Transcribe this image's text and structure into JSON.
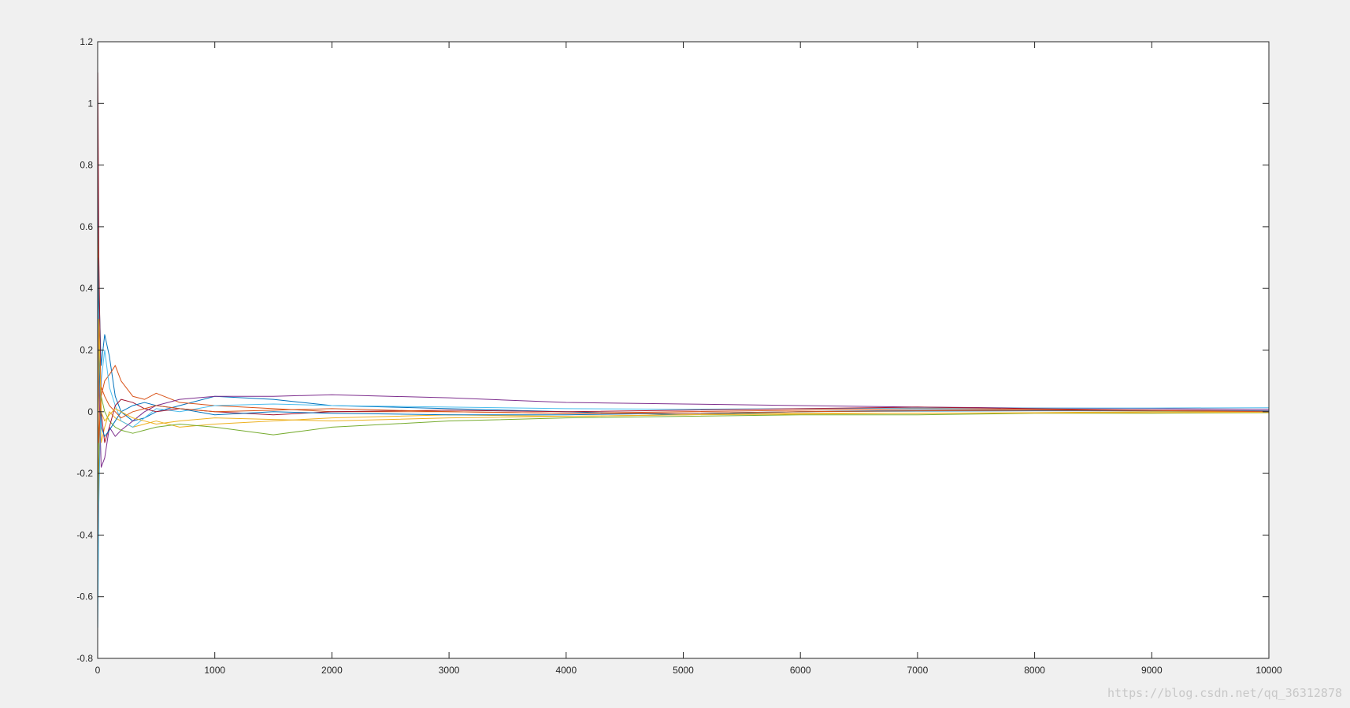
{
  "chart_data": {
    "type": "line",
    "title": "",
    "xlabel": "",
    "ylabel": "",
    "xlim": [
      0,
      10000
    ],
    "ylim": [
      -0.8,
      1.2
    ],
    "xticks": [
      0,
      1000,
      2000,
      3000,
      4000,
      5000,
      6000,
      7000,
      8000,
      9000,
      10000
    ],
    "yticks": [
      -0.8,
      -0.6,
      -0.4,
      -0.2,
      0,
      0.2,
      0.4,
      0.6,
      0.8,
      1,
      1.2
    ],
    "grid": false,
    "legend": "none",
    "series": [
      {
        "color": "#0072BD",
        "x": [
          1,
          10,
          30,
          60,
          100,
          150,
          200,
          300,
          400,
          500,
          700,
          1000,
          1500,
          2000,
          3000,
          4000,
          5000,
          6000,
          7000,
          8000,
          9000,
          10000
        ],
        "y": [
          0.8,
          0.4,
          0.15,
          0.25,
          0.18,
          0.05,
          0.0,
          -0.03,
          -0.02,
          0.0,
          0.02,
          0.05,
          0.04,
          0.02,
          0.01,
          0.0,
          -0.01,
          0.0,
          0.005,
          0.005,
          0.003,
          0.002
        ]
      },
      {
        "color": "#D95319",
        "x": [
          1,
          10,
          30,
          60,
          100,
          150,
          200,
          300,
          400,
          500,
          700,
          1000,
          1500,
          2000,
          3000,
          4000,
          5000,
          6000,
          7000,
          8000,
          9000,
          10000
        ],
        "y": [
          -0.5,
          -0.2,
          0.05,
          0.1,
          0.12,
          0.15,
          0.1,
          0.05,
          0.04,
          0.06,
          0.03,
          0.02,
          0.01,
          0.0,
          0.0,
          -0.005,
          0.0,
          0.005,
          0.01,
          0.008,
          0.005,
          0.002
        ]
      },
      {
        "color": "#EDB120",
        "x": [
          1,
          10,
          30,
          60,
          100,
          150,
          200,
          300,
          400,
          500,
          700,
          1000,
          1500,
          2000,
          3000,
          4000,
          5000,
          6000,
          7000,
          8000,
          9000,
          10000
        ],
        "y": [
          0.6,
          0.2,
          -0.1,
          -0.05,
          0.0,
          -0.02,
          -0.03,
          -0.05,
          -0.04,
          -0.03,
          -0.05,
          -0.04,
          -0.03,
          -0.02,
          -0.01,
          -0.015,
          -0.01,
          -0.005,
          -0.005,
          -0.003,
          0.0,
          0.0
        ]
      },
      {
        "color": "#7E2F8E",
        "x": [
          1,
          10,
          30,
          60,
          100,
          150,
          200,
          300,
          400,
          500,
          700,
          1000,
          1500,
          2000,
          3000,
          4000,
          5000,
          6000,
          7000,
          8000,
          9000,
          10000
        ],
        "y": [
          0.3,
          0.1,
          -0.18,
          -0.15,
          -0.05,
          -0.08,
          -0.06,
          -0.03,
          0.0,
          0.02,
          0.04,
          0.05,
          0.05,
          0.055,
          0.045,
          0.03,
          0.025,
          0.02,
          0.015,
          0.012,
          0.01,
          0.008
        ]
      },
      {
        "color": "#77AC30",
        "x": [
          1,
          10,
          30,
          60,
          100,
          150,
          200,
          300,
          400,
          500,
          700,
          1000,
          1500,
          2000,
          3000,
          4000,
          5000,
          6000,
          7000,
          8000,
          9000,
          10000
        ],
        "y": [
          -0.3,
          -0.1,
          0.05,
          0.0,
          -0.03,
          -0.05,
          -0.06,
          -0.07,
          -0.06,
          -0.05,
          -0.04,
          -0.05,
          -0.075,
          -0.05,
          -0.03,
          -0.02,
          -0.015,
          -0.01,
          -0.01,
          -0.005,
          -0.005,
          -0.003
        ]
      },
      {
        "color": "#4DBEEE",
        "x": [
          1,
          10,
          30,
          60,
          100,
          150,
          200,
          300,
          400,
          500,
          700,
          1000,
          1500,
          2000,
          3000,
          4000,
          5000,
          6000,
          7000,
          8000,
          9000,
          10000
        ],
        "y": [
          -0.7,
          -0.3,
          0.1,
          0.2,
          0.08,
          0.02,
          -0.03,
          -0.05,
          -0.02,
          0.01,
          0.0,
          0.02,
          0.025,
          0.02,
          0.015,
          0.01,
          0.008,
          0.01,
          0.012,
          0.012,
          0.012,
          0.013
        ]
      },
      {
        "color": "#A2142F",
        "x": [
          1,
          10,
          30,
          60,
          100,
          150,
          200,
          300,
          400,
          500,
          700,
          1000,
          1500,
          2000,
          3000,
          4000,
          5000,
          6000,
          7000,
          8000,
          9000,
          10000
        ],
        "y": [
          1.1,
          0.5,
          0.0,
          -0.1,
          -0.05,
          0.02,
          0.04,
          0.03,
          0.01,
          0.0,
          0.01,
          0.0,
          -0.01,
          0.0,
          0.005,
          0.0,
          0.005,
          0.01,
          0.015,
          0.01,
          0.005,
          0.003
        ]
      },
      {
        "color": "#0072BD",
        "x": [
          1,
          10,
          30,
          60,
          100,
          150,
          200,
          300,
          400,
          500,
          700,
          1000,
          1500,
          2000,
          3000,
          4000,
          5000,
          6000,
          7000,
          8000,
          9000,
          10000
        ],
        "y": [
          0.5,
          0.2,
          -0.05,
          -0.08,
          -0.06,
          -0.03,
          0.0,
          0.02,
          0.03,
          0.02,
          0.01,
          -0.01,
          0.0,
          -0.005,
          -0.01,
          -0.01,
          -0.005,
          0.0,
          0.002,
          0.003,
          0.003,
          0.002
        ]
      },
      {
        "color": "#D95319",
        "x": [
          1,
          10,
          30,
          60,
          100,
          150,
          200,
          300,
          400,
          500,
          700,
          1000,
          1500,
          2000,
          3000,
          4000,
          5000,
          6000,
          7000,
          8000,
          9000,
          10000
        ],
        "y": [
          0.2,
          -0.1,
          0.08,
          0.05,
          0.02,
          0.0,
          -0.02,
          0.0,
          0.01,
          0.02,
          0.01,
          0.0,
          0.005,
          0.01,
          0.0,
          -0.005,
          -0.005,
          0.0,
          0.003,
          0.005,
          0.004,
          0.0
        ]
      },
      {
        "color": "#EDB120",
        "x": [
          1,
          10,
          30,
          60,
          100,
          150,
          200,
          300,
          400,
          500,
          700,
          1000,
          1500,
          2000,
          3000,
          4000,
          5000,
          6000,
          7000,
          8000,
          9000,
          10000
        ],
        "y": [
          -0.2,
          0.3,
          0.0,
          -0.03,
          -0.01,
          0.01,
          0.0,
          -0.02,
          -0.03,
          -0.04,
          -0.03,
          -0.02,
          -0.025,
          -0.03,
          -0.02,
          -0.015,
          -0.01,
          -0.008,
          -0.005,
          -0.004,
          -0.003,
          -0.002
        ]
      }
    ]
  },
  "watermark": "https://blog.csdn.net/qq_36312878"
}
